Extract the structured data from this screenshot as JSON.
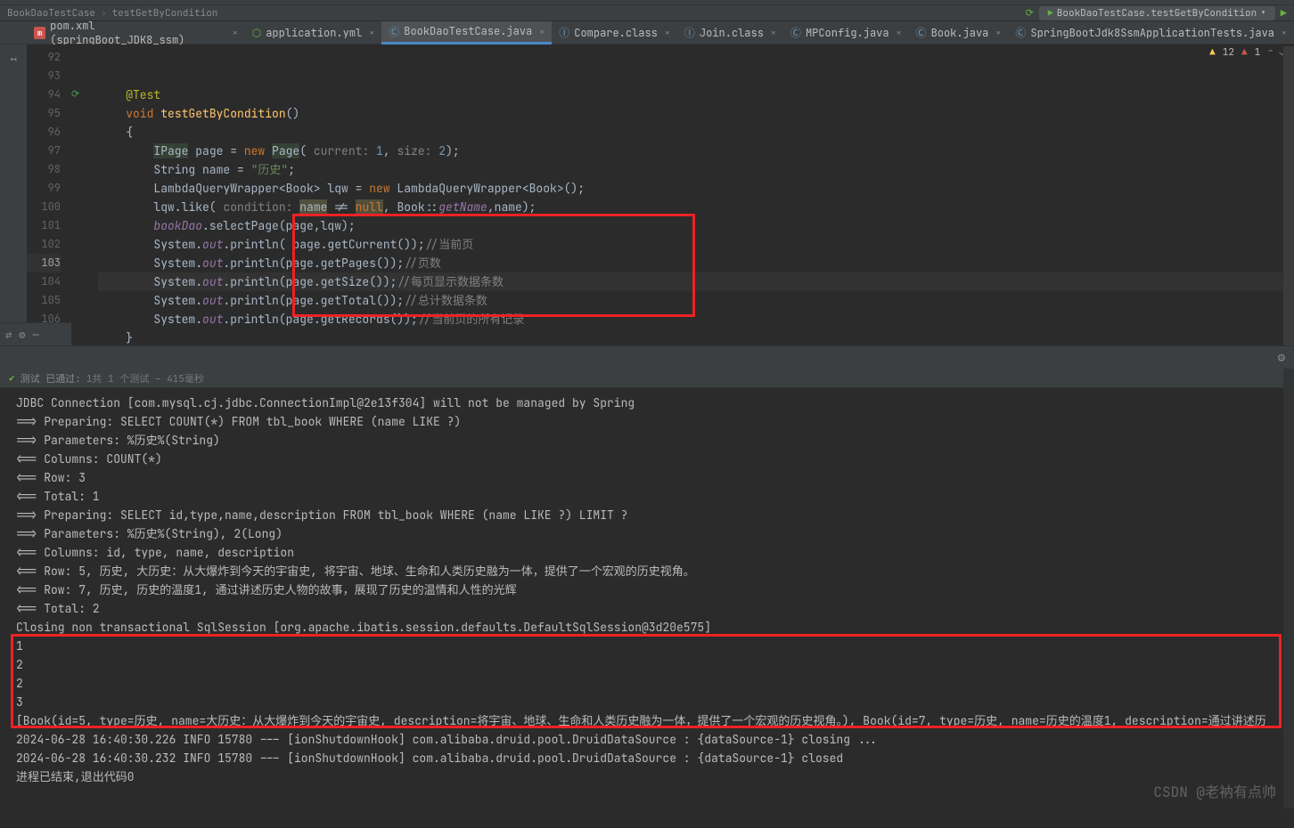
{
  "breadcrumb": {
    "item1": "BookDaoTestCase",
    "item2": "testGetByCondition"
  },
  "runConfig": {
    "label": "BookDaoTestCase.testGetByCondition"
  },
  "tabs": [
    {
      "label": "pom.xml (springBoot_JDK8_ssm)",
      "icon": "m"
    },
    {
      "label": "application.yml",
      "icon": "yml"
    },
    {
      "label": "BookDaoTestCase.java",
      "icon": "java",
      "active": true
    },
    {
      "label": "Compare.class",
      "icon": "cls"
    },
    {
      "label": "Join.class",
      "icon": "cls"
    },
    {
      "label": "MPConfig.java",
      "icon": "java"
    },
    {
      "label": "Book.java",
      "icon": "java"
    },
    {
      "label": "SpringBootJdk8SsmApplicationTests.java",
      "icon": "java"
    }
  ],
  "warnings": {
    "w": "12",
    "e": "1"
  },
  "lines": {
    "start": 92,
    "end": 106,
    "highlight": 103
  },
  "code": {
    "l93": "@Test",
    "l94_void": "void ",
    "l94_fn": "testGetByCondition",
    "l94_end": "()",
    "l95": "{",
    "l96_a": "IPage",
    "l96_b": " page = ",
    "l96_new": "new ",
    "l96_c": "Page",
    "l96_d": "( ",
    "l96_p1": "current: ",
    "l96_n1": "1",
    "l96_e": ", ",
    "l96_p2": "size: ",
    "l96_n2": "2",
    "l96_f": ");",
    "l97_a": "String name = ",
    "l97_s": "\"历史\"",
    "l97_b": ";",
    "l98_a": "LambdaQueryWrapper<Book> lqw = ",
    "l98_new": "new ",
    "l98_b": "LambdaQueryWrapper<Book>();",
    "l99_a": "lqw.like( ",
    "l99_p": "condition: ",
    "l99_name": "name",
    "l99_b": " != ",
    "l99_null": "null",
    "l99_c": ", Book::",
    "l99_fn": "getName",
    "l99_d": ",name);",
    "l100_a": "bookDao",
    "l100_b": ".selectPage(page,lqw);",
    "l101_a": "System.",
    "l101_out": "out",
    "l101_b": ".println( page.getCurrent());",
    "l101_c": "//当前页",
    "l102_a": "System.",
    "l102_out": "out",
    "l102_b": ".println(page.getPages());",
    "l102_c": "//页数",
    "l103_a": "System.",
    "l103_out": "out",
    "l103_b": ".println(page.getSize());",
    "l103_c": "//每页显示数据条数",
    "l104_a": "System.",
    "l104_out": "out",
    "l104_b": ".println(page.getTotal());",
    "l104_c": "//总计数据条数",
    "l105_a": "System.",
    "l105_out": "out",
    "l105_b": ".println(page.getRecords());",
    "l105_c": "//当前页的所有记录",
    "l106": "}"
  },
  "testStatus": {
    "label": "测试 已通过:",
    "detail": "1共 1 个测试 – 415毫秒"
  },
  "console": {
    "l1": "JDBC Connection [com.mysql.cj.jdbc.ConnectionImpl@2e13f304] will not be managed by Spring",
    "l2": "==>  Preparing: SELECT COUNT(*) FROM tbl_book WHERE (name LIKE ?)",
    "l3": "==> Parameters: %历史%(String)",
    "l4": "<==    Columns: COUNT(*)",
    "l5": "<==        Row: 3",
    "l6": "<==      Total: 1",
    "l7": "==>  Preparing: SELECT id,type,name,description FROM tbl_book WHERE (name LIKE ?) LIMIT ?",
    "l8": "==> Parameters: %历史%(String), 2(Long)",
    "l9": "<==    Columns: id, type, name, description",
    "l10": "<==        Row: 5, 历史, 大历史：从大爆炸到今天的宇宙史, 将宇宙、地球、生命和人类历史融为一体，提供了一个宏观的历史视角。",
    "l11": "<==        Row: 7, 历史, 历史的温度1, 通过讲述历史人物的故事，展现了历史的温情和人性的光辉",
    "l12": "<==      Total: 2",
    "l13": "Closing non transactional SqlSession [org.apache.ibatis.session.defaults.DefaultSqlSession@3d20e575]",
    "l14": "1",
    "l15": "2",
    "l16": "2",
    "l17": "3",
    "l18": "[Book(id=5, type=历史, name=大历史：从大爆炸到今天的宇宙史, description=将宇宙、地球、生命和人类历史融为一体，提供了一个宏观的历史视角。), Book(id=7, type=历史, name=历史的温度1, description=通过讲述历",
    "l19": "2024-06-28 16:40:30.226  INFO 15780 --- [ionShutdownHook] com.alibaba.druid.pool.DruidDataSource   : {dataSource-1} closing ...",
    "l20": "2024-06-28 16:40:30.232  INFO 15780 --- [ionShutdownHook] com.alibaba.druid.pool.DruidDataSource   : {dataSource-1} closed",
    "l21": "",
    "l22": "进程已结束,退出代码0"
  },
  "watermark": "CSDN @老衲有点帅"
}
